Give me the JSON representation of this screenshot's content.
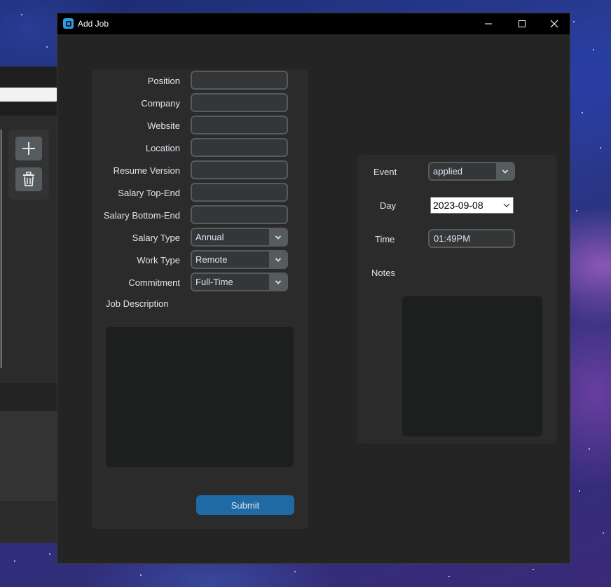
{
  "window": {
    "title": "Add Job",
    "controls": {
      "minimize": "minimize-icon",
      "maximize": "maximize-icon",
      "close": "close-icon"
    }
  },
  "job_form": {
    "fields": [
      {
        "label": "Position",
        "value": ""
      },
      {
        "label": "Company",
        "value": ""
      },
      {
        "label": "Website",
        "value": ""
      },
      {
        "label": "Location",
        "value": ""
      },
      {
        "label": "Resume Version",
        "value": ""
      },
      {
        "label": "Salary Top-End",
        "value": ""
      },
      {
        "label": "Salary Bottom-End",
        "value": ""
      }
    ],
    "salary_type": {
      "label": "Salary Type",
      "value": "Annual"
    },
    "work_type": {
      "label": "Work Type",
      "value": "Remote"
    },
    "commitment": {
      "label": "Commitment",
      "value": "Full-Time"
    },
    "description": {
      "label": "Job Description",
      "value": ""
    },
    "submit_label": "Submit"
  },
  "event_form": {
    "event": {
      "label": "Event",
      "value": "applied"
    },
    "day": {
      "label": "Day",
      "value": "2023-09-08"
    },
    "time": {
      "label": "Time",
      "value": "01:49PM"
    },
    "notes": {
      "label": "Notes",
      "value": ""
    }
  },
  "background_app": {
    "add_icon": "plus-icon",
    "delete_icon": "trash-icon"
  },
  "colors": {
    "accent": "#1f6aa5",
    "window_bg": "#242424",
    "frame_bg": "#2b2b2b",
    "entry_bg": "#343638",
    "entry_border": "#565b5e",
    "textbox_bg": "#1d1e1e",
    "titlebar": "#000000"
  }
}
